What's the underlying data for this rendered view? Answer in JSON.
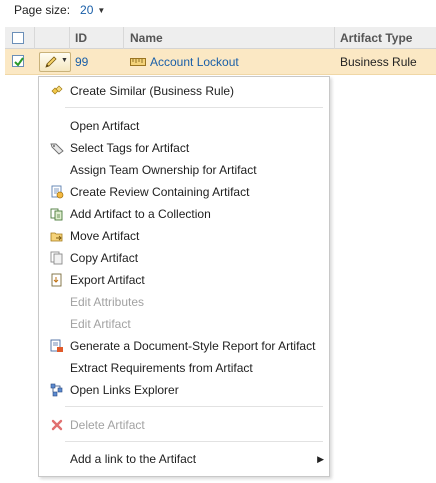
{
  "page_size": {
    "label": "Page size:",
    "value": "20"
  },
  "grid": {
    "columns": {
      "id": "ID",
      "name": "Name",
      "type": "Artifact Type"
    },
    "row": {
      "id": "99",
      "name": "Account Lockout",
      "type": "Business Rule"
    }
  },
  "menu": {
    "create_similar": "Create Similar (Business Rule)",
    "open_artifact": "Open Artifact",
    "select_tags": "Select Tags for Artifact",
    "assign_ownership": "Assign Team Ownership for Artifact",
    "create_review": "Create Review Containing Artifact",
    "add_to_collection": "Add Artifact to a Collection",
    "move": "Move Artifact",
    "copy": "Copy Artifact",
    "export": "Export Artifact",
    "edit_attributes": "Edit Attributes",
    "edit_artifact": "Edit Artifact",
    "generate_report": "Generate a Document-Style Report for Artifact",
    "extract_requirements": "Extract Requirements from Artifact",
    "open_links_explorer": "Open Links Explorer",
    "delete": "Delete Artifact",
    "add_link": "Add a link to the Artifact"
  },
  "colors": {
    "link": "#1a5fa8",
    "selected_row": "#fbe8c4",
    "disabled_text": "#a2a2a2",
    "delete_icon": "#e07070"
  }
}
